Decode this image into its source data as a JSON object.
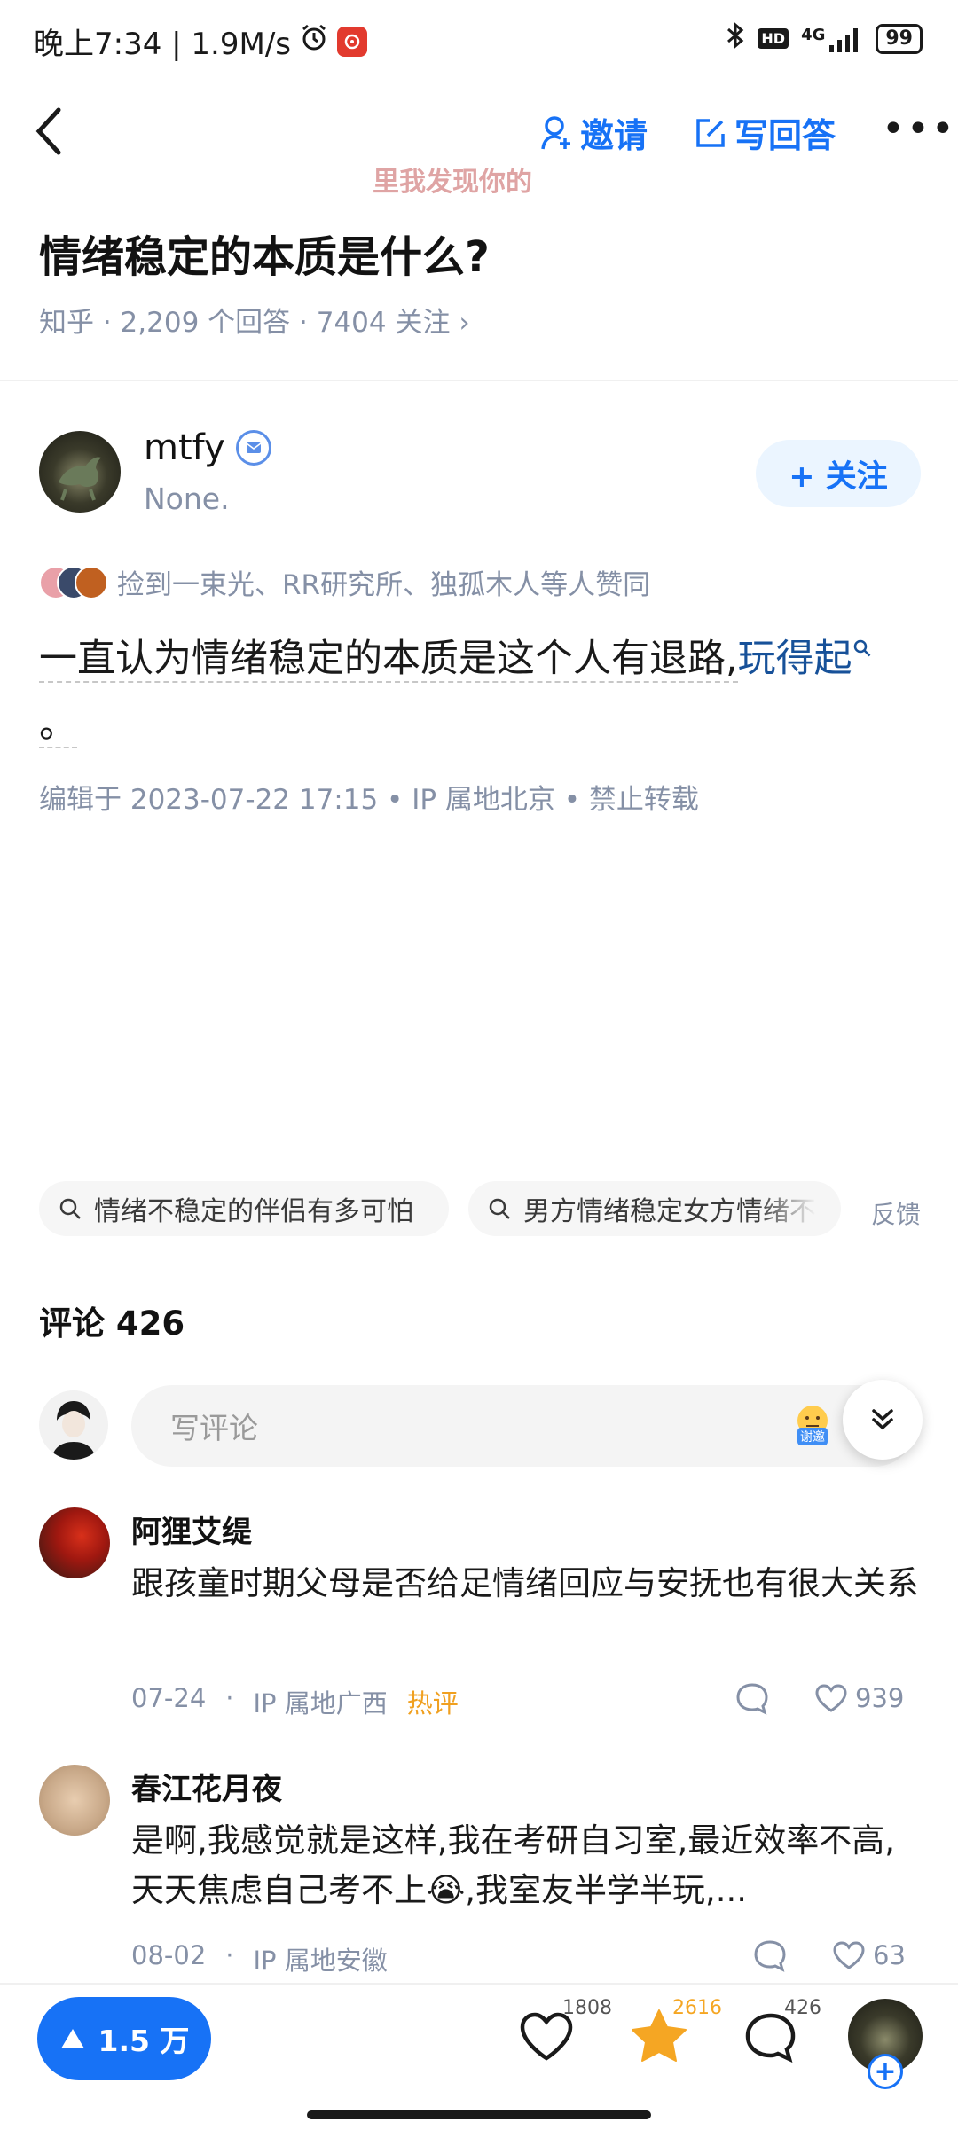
{
  "status_bar": {
    "time_speed": "晚上7:34 | 1.9M/s",
    "network": "4G",
    "battery": "99",
    "hd": "HD"
  },
  "header": {
    "invite_label": "邀请",
    "write_label": "写回答",
    "more_label": "•••",
    "ticker": "里我发现你的"
  },
  "question": {
    "title": "情绪稳定的本质是什么?",
    "meta": "知乎 · 2,209 个回答 · 7404 关注 ›"
  },
  "author": {
    "name": "mtfy",
    "bio": "None.",
    "follow_label": "+ 关注"
  },
  "answer": {
    "liked_by": "捡到一束光、RR研究所、独孤木人等人赞同",
    "text_part1": "一直认为情绪稳定的本质是这个人有退路,",
    "text_link": "玩得起",
    "text_end": "。",
    "edited": "编辑于 2023-07-22 17:15 • IP 属地北京 • 禁止转载"
  },
  "related_tags": [
    {
      "label": "情绪不稳定的伴侣有多可怕"
    },
    {
      "label": "男方情绪稳定女方情绪不"
    }
  ],
  "feedback_label": "反馈",
  "comments": {
    "heading": "评论 426",
    "input_placeholder": "写评论",
    "emoji_badge": "谢邀",
    "items": [
      {
        "name": "阿狸艾缇",
        "text": "跟孩童时期父母是否给足情绪回应与安抚也有很大关系",
        "date": "07-24",
        "location": "IP 属地广西",
        "badge": "热评",
        "likes": "939"
      },
      {
        "name": "春江花月夜",
        "text": "是啊,我感觉就是这样,我在考研自习室,最近效率不高,天天焦虑自己考不上😭,我室友半学半玩,...",
        "date": "08-02",
        "location": "IP 属地安徽",
        "badge": "",
        "likes": "63"
      }
    ]
  },
  "bottom_bar": {
    "vote_label": "1.5 万",
    "like_count": "1808",
    "star_count": "2616",
    "comment_count": "426"
  },
  "colors": {
    "brand_blue": "#1772f6",
    "meta_gray": "#8590a6",
    "hot_orange": "#f0a020",
    "star_orange": "#f5a623"
  }
}
